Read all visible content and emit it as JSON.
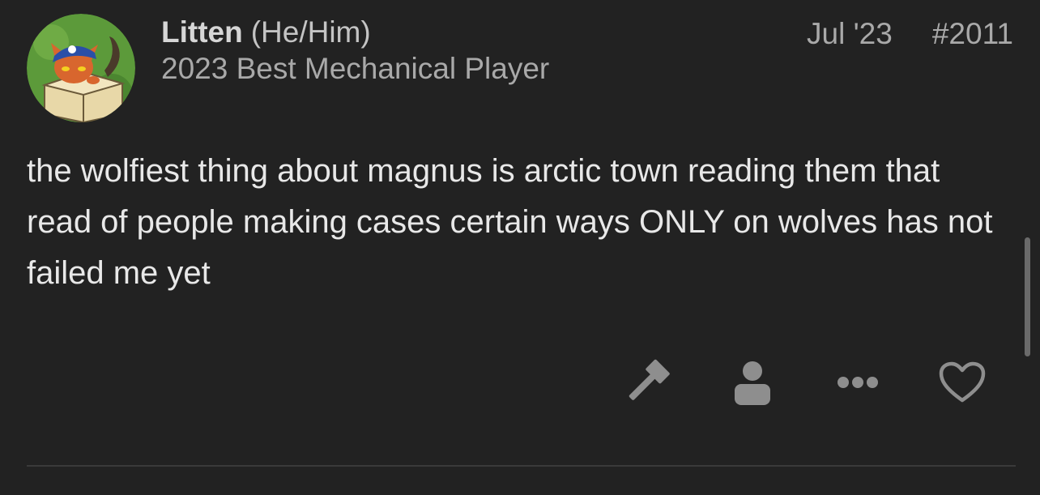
{
  "post": {
    "author": {
      "username": "Litten",
      "pronouns": "(He/Him)",
      "title": "2023 Best Mechanical Player",
      "avatar_icon": "cat-in-box-avatar-icon"
    },
    "date": "Jul '23",
    "number": "#2011",
    "body": "the wolfiest thing about magnus is arctic town reading them that read of people making cases certain ways ONLY on wolves has not failed me yet",
    "actions": [
      {
        "name": "flag",
        "icon": "gavel-icon"
      },
      {
        "name": "admin",
        "icon": "user-icon"
      },
      {
        "name": "more",
        "icon": "ellipsis-icon"
      },
      {
        "name": "like",
        "icon": "heart-icon"
      }
    ]
  },
  "colors": {
    "background": "#222222",
    "body_text": "#e8e8e8",
    "muted_text": "#a9a9a9",
    "icon": "#8e8e8e",
    "divider": "#3a3a3a"
  }
}
